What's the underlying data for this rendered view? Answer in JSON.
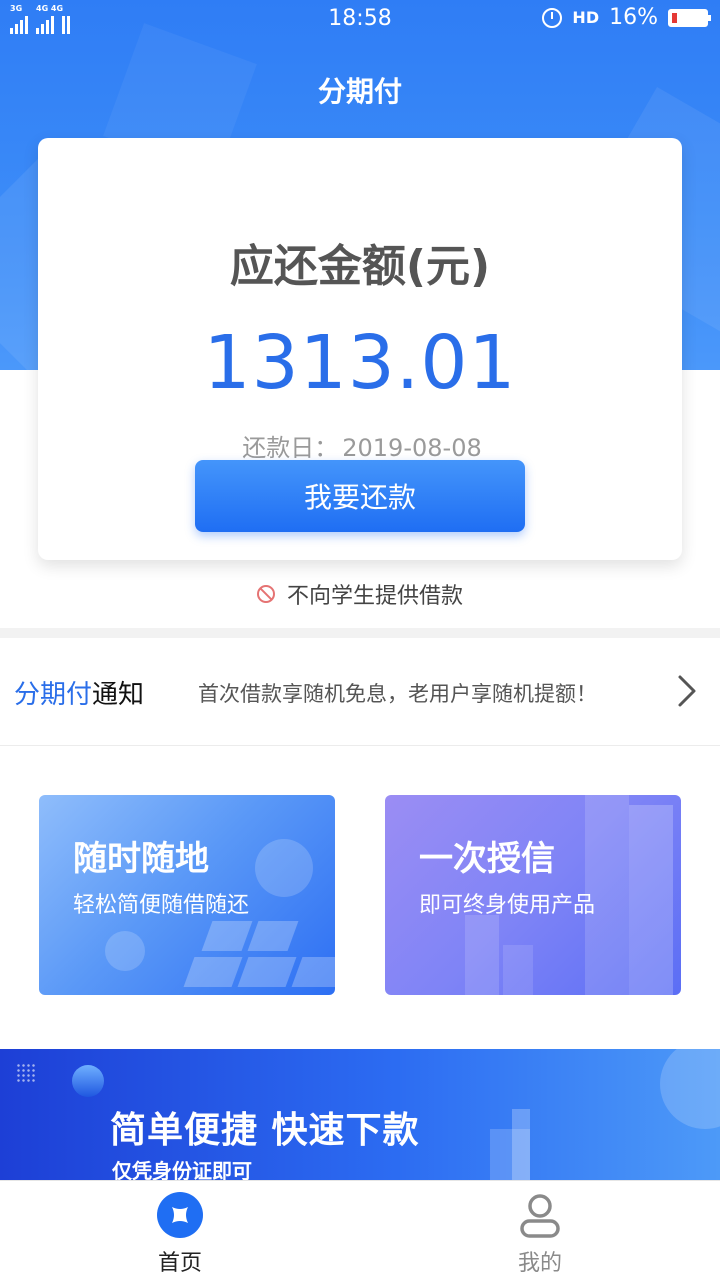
{
  "status_bar": {
    "time": "18:58",
    "signal_tag_1": "3G",
    "signal_tag_2": "4G 4G",
    "call_tag": "HD",
    "battery": "16%"
  },
  "header": {
    "title": "分期付"
  },
  "repay_card": {
    "label": "应还金额(元)",
    "amount": "1313.01",
    "due_label": "还款日：",
    "due_date": "2019-08-08",
    "button": "我要还款"
  },
  "student_notice": "不向学生提供借款",
  "announcement": {
    "brand_part1": "分期付",
    "brand_part2": "通知",
    "text": "首次借款享随机免息，老用户享随机提额！"
  },
  "features": [
    {
      "title": "随时随地",
      "subtitle": "轻松简便随借随还"
    },
    {
      "title": "一次授信",
      "subtitle": "即可终身使用产品"
    }
  ],
  "promo": {
    "title": "简单便捷 快速下款",
    "subtitle": "仅凭身份证即可"
  },
  "tabbar": {
    "home": "首页",
    "mine": "我的"
  },
  "colors": {
    "brand_blue": "#2a6ee9",
    "button_top": "#4495fb",
    "button_bottom": "#1f6ef3",
    "battery_low": "#e53935"
  },
  "icons": {
    "home_tab": "home-logo-icon",
    "mine_tab": "user-icon",
    "announcement_arrow": "chevron-right-icon",
    "student_notice": "prohibited-icon"
  }
}
